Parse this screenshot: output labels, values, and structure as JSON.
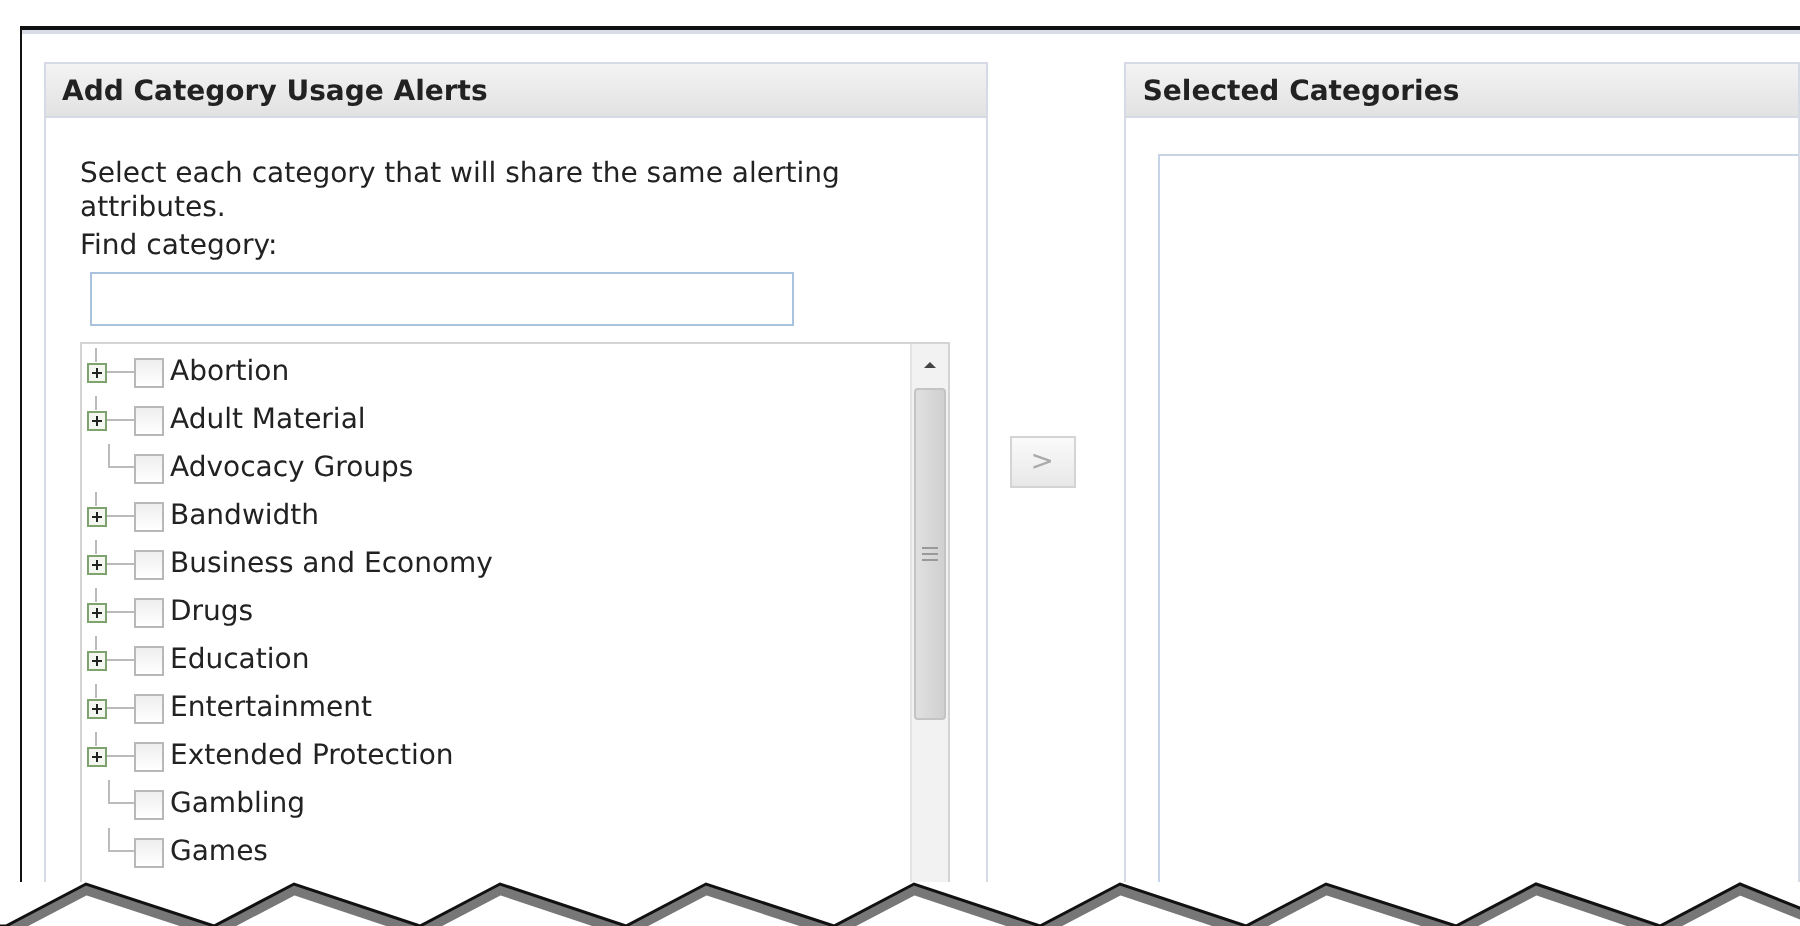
{
  "left_panel": {
    "title": "Add Category Usage Alerts",
    "instructions": "Select each category that will share the same alerting attributes.",
    "find_label": "Find category:",
    "tree": [
      {
        "label": "Abortion",
        "kind": "branch",
        "checked": false
      },
      {
        "label": "Adult Material",
        "kind": "branch",
        "checked": false
      },
      {
        "label": "Advocacy Groups",
        "kind": "leaf",
        "checked": false
      },
      {
        "label": "Bandwidth",
        "kind": "branch",
        "checked": false
      },
      {
        "label": "Business and Economy",
        "kind": "branch",
        "checked": false
      },
      {
        "label": "Drugs",
        "kind": "branch",
        "checked": false
      },
      {
        "label": "Education",
        "kind": "branch",
        "checked": false
      },
      {
        "label": "Entertainment",
        "kind": "branch",
        "checked": false
      },
      {
        "label": "Extended Protection",
        "kind": "branch",
        "checked": false
      },
      {
        "label": "Gambling",
        "kind": "leaf",
        "checked": false
      },
      {
        "label": "Games",
        "kind": "leaf",
        "checked": false
      }
    ]
  },
  "add_button": {
    "label": ">",
    "disabled": true
  },
  "right_panel": {
    "title": "Selected Categories"
  }
}
